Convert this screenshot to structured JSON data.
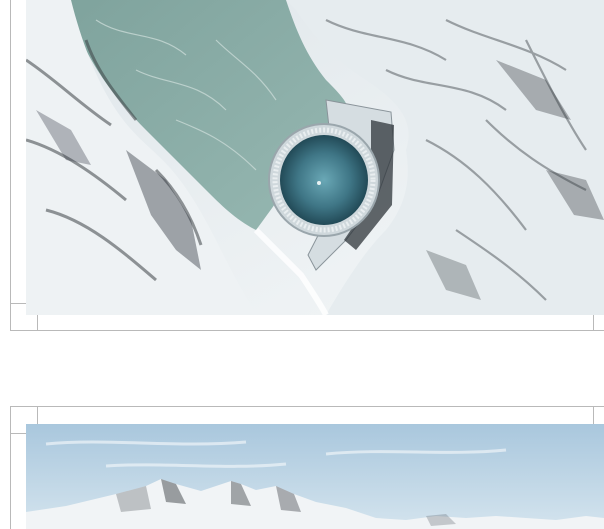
{
  "photos": [
    {
      "subject": "aerial-alpine-reservoir-with-circular-solar-structure",
      "palette": {
        "snow": "#eef2f4",
        "rock": "#2f3438",
        "lake": "#8fb0aa",
        "disc": "#3f7686"
      }
    },
    {
      "subject": "snowy-mountain-range-under-sky",
      "palette": {
        "sky": "#b9d2e4",
        "snow": "#f1f4f6",
        "rock": "#4f5358"
      }
    }
  ]
}
